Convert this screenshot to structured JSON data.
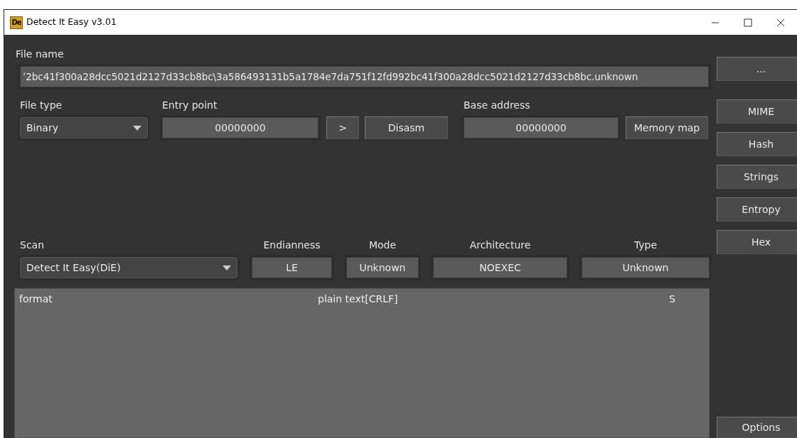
{
  "window": {
    "title": "Detect It Easy v3.01",
    "app_icon": "De"
  },
  "file_name": {
    "label": "File name",
    "value": "ʼ2bc41f300a28dcc5021d2127d33cb8bc\\3a586493131b5a1784e7da751f12fd992bc41f300a28dcc5021d2127d33cb8bc.unknown",
    "browse_button": "..."
  },
  "file_type": {
    "label": "File type",
    "value": "Binary"
  },
  "entry_point": {
    "label": "Entry point",
    "value": "00000000",
    "go_button": ">",
    "disasm_button": "Disasm"
  },
  "base_address": {
    "label": "Base address",
    "value": "00000000",
    "memory_map_button": "Memory map"
  },
  "scan": {
    "label": "Scan",
    "value": "Detect It Easy(DiE)"
  },
  "info_fields": [
    {
      "label": "Endianness",
      "value": "LE"
    },
    {
      "label": "Mode",
      "value": "Unknown"
    },
    {
      "label": "Architecture",
      "value": "NOEXEC"
    },
    {
      "label": "Type",
      "value": "Unknown"
    }
  ],
  "results": [
    {
      "column_1": "format",
      "column_2": "plain text[CRLF]",
      "column_3": "S"
    }
  ],
  "side_buttons": [
    "MIME",
    "Hash",
    "Strings",
    "Entropy",
    "Hex"
  ],
  "options_button": "Options"
}
